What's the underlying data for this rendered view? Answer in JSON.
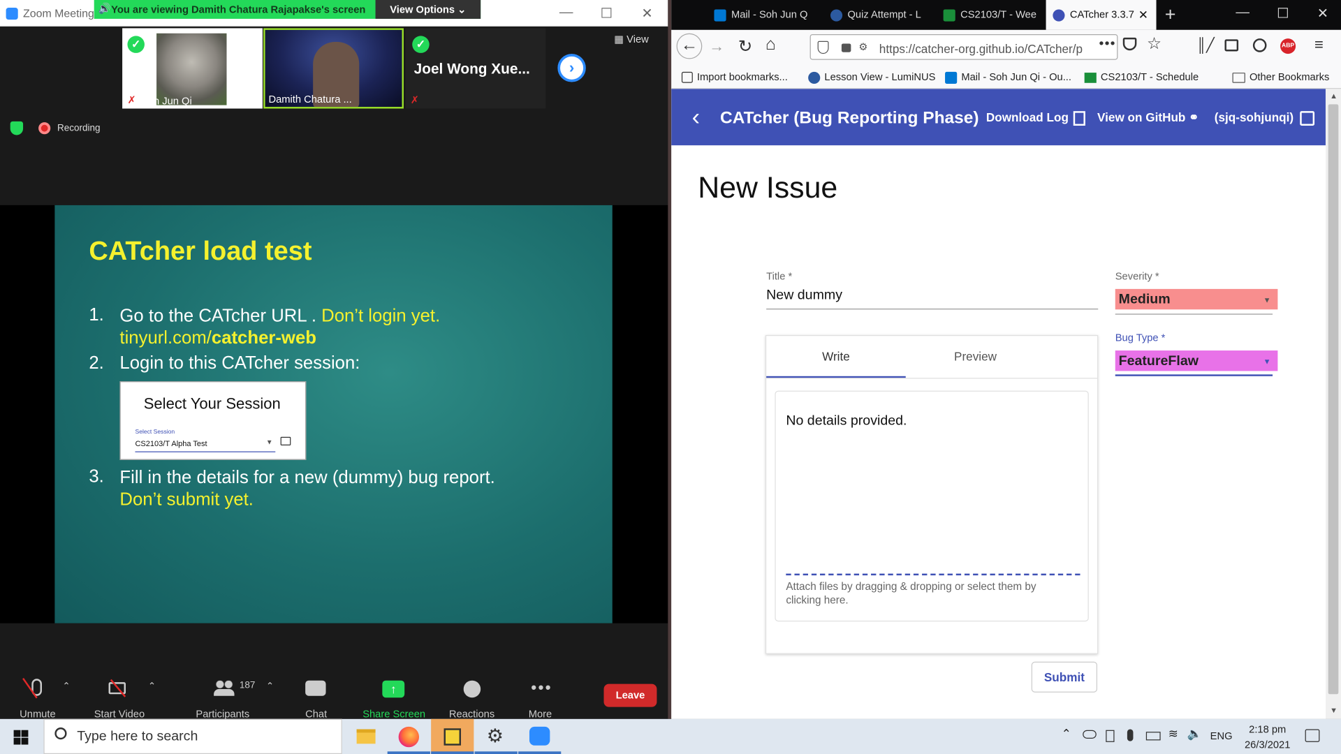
{
  "zoom": {
    "window_title": "Zoom Meeting",
    "banner_text": "You are viewing Damith Chatura Rajapakse's screen",
    "view_options": "View Options",
    "view_label": "View",
    "recording": "Recording",
    "participants_tiles": [
      {
        "name": "Soh Jun Qi"
      },
      {
        "name": "Damith Chatura ..."
      },
      {
        "name": "Joel Wong Xue..."
      }
    ],
    "slide": {
      "title": "CATcher load test",
      "items": [
        {
          "num": "1.",
          "text": "Go to the CATcher URL . ",
          "highlight": "Don’t login yet.",
          "url_pre": "tinyurl.com/",
          "url_bold": "catcher-web"
        },
        {
          "num": "2.",
          "text": "Login to this CATcher session:"
        },
        {
          "num": "3.",
          "text": "Fill in the details for a new (dummy) bug report.",
          "highlight": "Don’t submit yet."
        }
      ],
      "session_box": {
        "title": "Select Your Session",
        "label": "Select Session",
        "value": "CS2103/T Alpha Test"
      }
    },
    "toolbar": {
      "unmute": "Unmute",
      "start_video": "Start Video",
      "participants": "Participants",
      "participants_count": "187",
      "chat": "Chat",
      "share_screen": "Share Screen",
      "reactions": "Reactions",
      "more": "More",
      "leave": "Leave"
    }
  },
  "browser": {
    "tabs": [
      {
        "label": "Mail - Soh Jun Q",
        "icon_color": "#0078d4"
      },
      {
        "label": "Quiz Attempt - L",
        "icon_color": "#2c5aa0"
      },
      {
        "label": "CS2103/T - Wee",
        "icon_color": "#1a8f3a"
      },
      {
        "label": "CATcher 3.3.7",
        "icon_color": "#3f51b5",
        "active": true
      }
    ],
    "url": "https://catcher-org.github.io/CATcher/p",
    "bookmarks": [
      {
        "label": "Import bookmarks..."
      },
      {
        "label": "Lesson View - LumiNUS"
      },
      {
        "label": "Mail - Soh Jun Qi - Ou..."
      },
      {
        "label": "CS2103/T - Schedule"
      },
      {
        "label": "Other Bookmarks"
      }
    ]
  },
  "catcher": {
    "title": "CATcher  (Bug Reporting Phase)",
    "download_log": "Download Log",
    "view_github": "View on GitHub",
    "user": "(sjq-sohjunqi)",
    "heading": "New Issue",
    "title_label": "Title *",
    "title_value": "New dummy",
    "severity_label": "Severity *",
    "severity_value": "Medium",
    "severity_color": "#f88e8e",
    "bugtype_label": "Bug Type *",
    "bugtype_value": "FeatureFlaw",
    "bugtype_color": "#e872e8",
    "tab_write": "Write",
    "tab_preview": "Preview",
    "description": "No details provided.",
    "attach_hint": "Attach files by dragging & dropping or select them by clicking here.",
    "submit": "Submit"
  },
  "taskbar": {
    "search_placeholder": "Type here to search",
    "language": "ENG",
    "time": "2:18 pm",
    "date": "26/3/2021"
  }
}
